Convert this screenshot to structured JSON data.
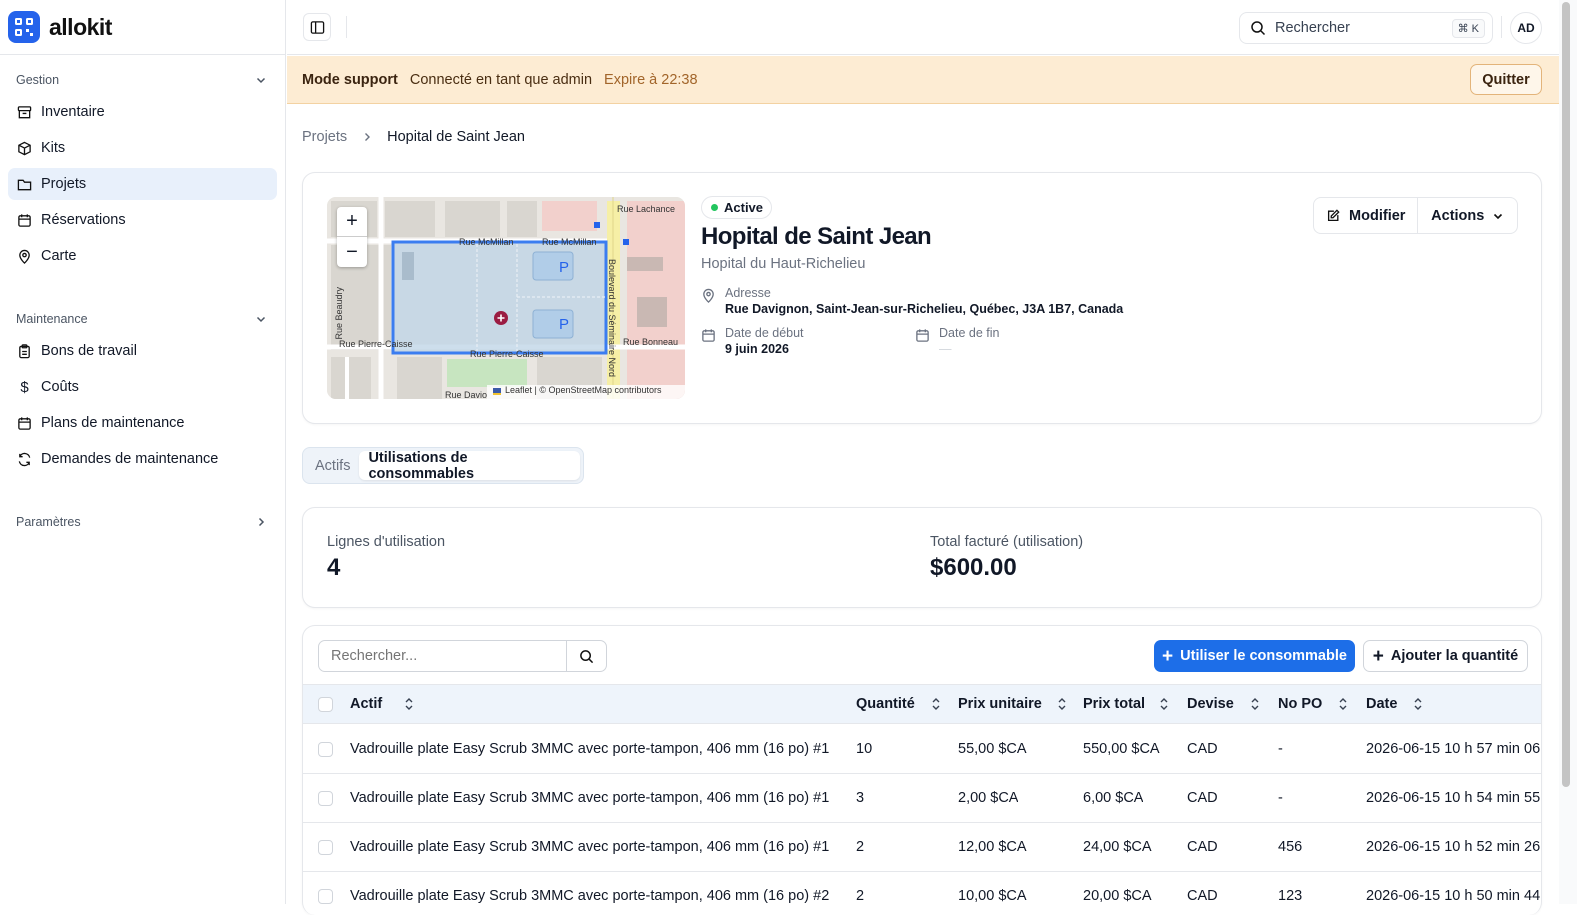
{
  "app": {
    "name": "allokit"
  },
  "sidebar": {
    "sections": [
      {
        "label": "Gestion"
      },
      {
        "label": "Maintenance"
      },
      {
        "label": "Paramètres"
      }
    ],
    "gestion_items": [
      {
        "label": "Inventaire",
        "icon": "archive-icon"
      },
      {
        "label": "Kits",
        "icon": "box-icon"
      },
      {
        "label": "Projets",
        "icon": "folder-icon",
        "active": true
      },
      {
        "label": "Réservations",
        "icon": "calendar-icon"
      },
      {
        "label": "Carte",
        "icon": "map-pin-icon"
      }
    ],
    "maintenance_items": [
      {
        "label": "Bons de travail",
        "icon": "clipboard-icon"
      },
      {
        "label": "Coûts",
        "icon": "dollar-icon"
      },
      {
        "label": "Plans de maintenance",
        "icon": "calendar-icon"
      },
      {
        "label": "Demandes de maintenance",
        "icon": "refresh-icon"
      }
    ]
  },
  "topbar": {
    "search_label": "Rechercher",
    "shortcut": "⌘ K",
    "avatar": "AD"
  },
  "banner": {
    "mode": "Mode support",
    "connected": "Connecté en tant que admin",
    "expires": "Expire à 22:38",
    "quit_label": "Quitter"
  },
  "breadcrumb": {
    "parent": "Projets",
    "current": "Hopital de Saint Jean"
  },
  "project": {
    "status": "Active",
    "title": "Hopital de Saint Jean",
    "subtitle": "Hopital du Haut-Richelieu",
    "address_label": "Adresse",
    "address": "Rue Davignon, Saint-Jean-sur-Richelieu, Québec, J3A 1B7, Canada",
    "start_label": "Date de début",
    "start": "9 juin 2026",
    "end_label": "Date de fin",
    "end": "—",
    "edit_label": "Modifier",
    "actions_label": "Actions",
    "status_color": "#22c55e"
  },
  "map": {
    "zoom_in": "+",
    "zoom_out": "−",
    "streets": [
      "Rue Lachance",
      "Rue McMillan",
      "Rue McMillan",
      "Boulevard du Séminaire Nord",
      "Rue Beaudry",
      "Rue Pierre-Caisse",
      "Rue Pierre-Caisse",
      "Rue Bonneau",
      "Rue Davio"
    ],
    "parking": "P",
    "attribution": "Leaflet | © OpenStreetMap contributors"
  },
  "tabs": [
    {
      "label": "Actifs",
      "active": false
    },
    {
      "label": "Utilisations de consommables",
      "active": true
    }
  ],
  "stats": [
    {
      "label": "Lignes d'utilisation",
      "value": "4"
    },
    {
      "label": "Total facturé (utilisation)",
      "value": "$600.00"
    }
  ],
  "table_toolbar": {
    "search_placeholder": "Rechercher...",
    "use_label": "Utiliser le consommable",
    "add_label": "Ajouter la quantité"
  },
  "table": {
    "columns": [
      "Actif",
      "Quantité",
      "Prix unitaire",
      "Prix total",
      "Devise",
      "No PO",
      "Date"
    ],
    "rows": [
      [
        "Vadrouille plate Easy Scrub 3MMC avec porte-tampon, 406 mm (16 po) #1",
        "10",
        "55,00 $CA",
        "550,00 $CA",
        "CAD",
        "-",
        "2026-06-15 10 h 57 min 06"
      ],
      [
        "Vadrouille plate Easy Scrub 3MMC avec porte-tampon, 406 mm (16 po) #1",
        "3",
        "2,00 $CA",
        "6,00 $CA",
        "CAD",
        "-",
        "2026-06-15 10 h 54 min 55"
      ],
      [
        "Vadrouille plate Easy Scrub 3MMC avec porte-tampon, 406 mm (16 po) #1",
        "2",
        "12,00 $CA",
        "24,00 $CA",
        "CAD",
        "456",
        "2026-06-15 10 h 52 min 26"
      ],
      [
        "Vadrouille plate Easy Scrub 3MMC avec porte-tampon, 406 mm (16 po) #2",
        "2",
        "10,00 $CA",
        "20,00 $CA",
        "CAD",
        "123",
        "2026-06-15 10 h 50 min 44"
      ]
    ]
  },
  "colors": {
    "accent": "#2563eb",
    "banner_bg": "#fdecd3",
    "active_nav": "#e8f0fb"
  }
}
